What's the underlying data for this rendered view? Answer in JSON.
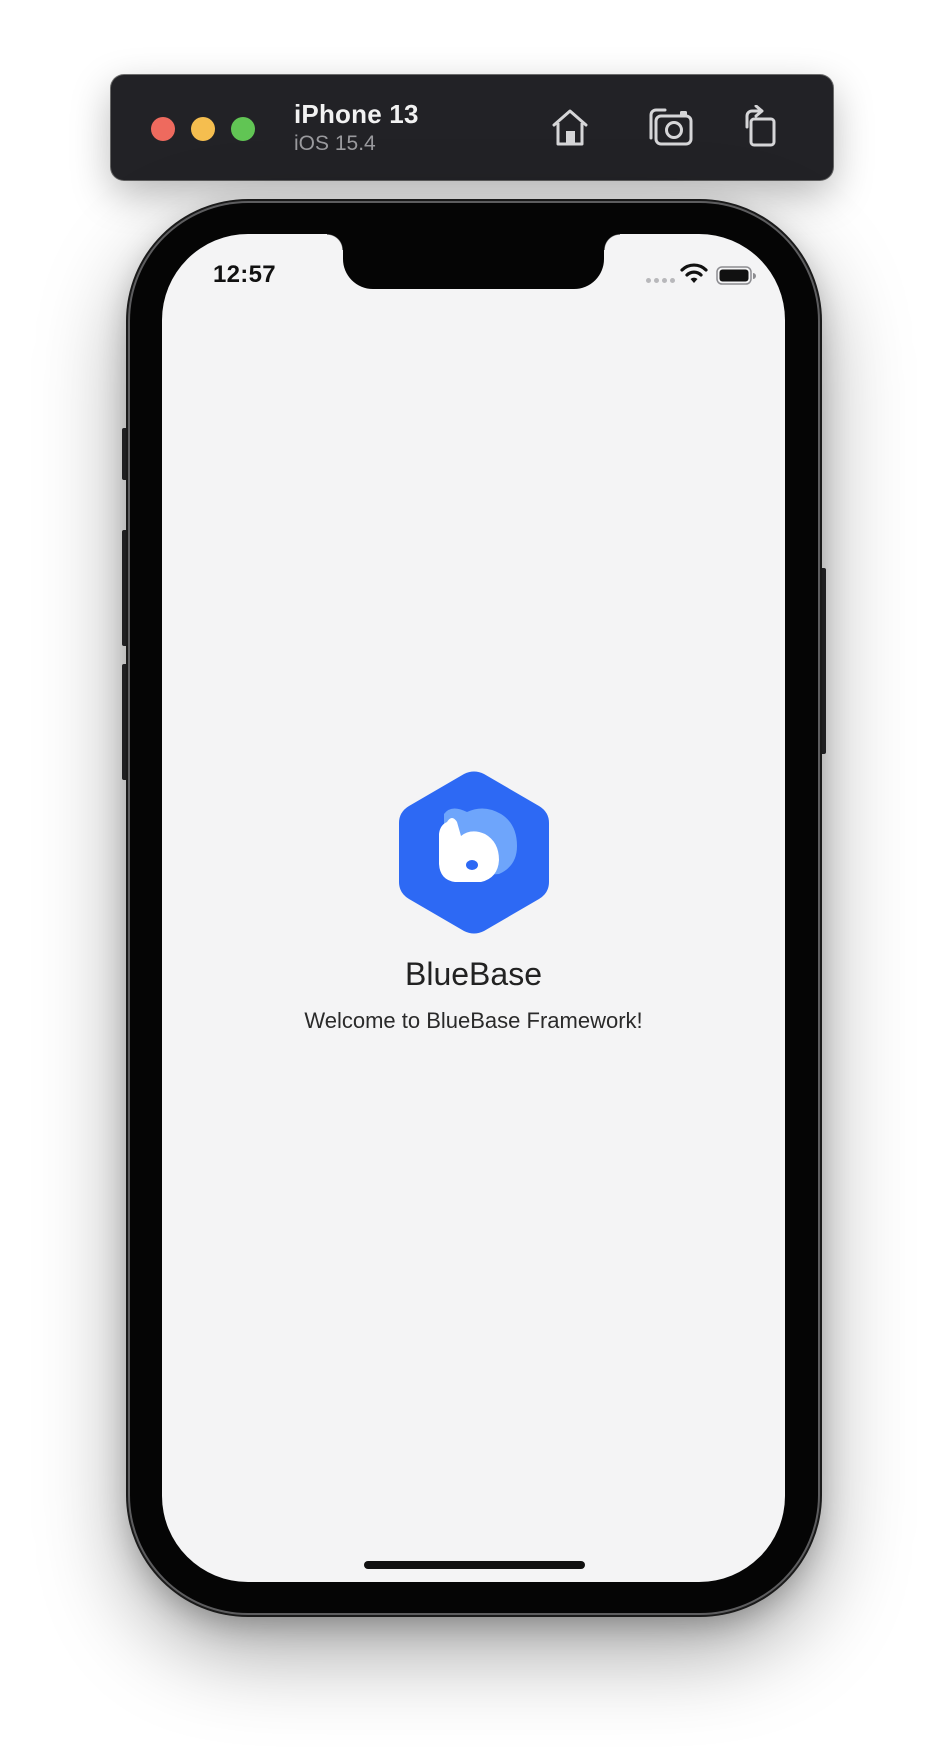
{
  "toolbar": {
    "device_name": "iPhone 13",
    "os_version": "iOS 15.4",
    "icons": {
      "close": "close-traffic-light",
      "minimize": "minimize-traffic-light",
      "zoom": "zoom-traffic-light",
      "home": "home-icon",
      "screenshot": "camera-icon",
      "rotate": "rotate-icon"
    },
    "colors": {
      "background": "#222226",
      "close": "#ee6a5e",
      "minimize": "#f5be4f",
      "zoom": "#61c554"
    }
  },
  "status_bar": {
    "time": "12:57",
    "icons": [
      "signal-icon",
      "wifi-icon",
      "battery-icon"
    ]
  },
  "app": {
    "title": "BlueBase",
    "subtitle": "Welcome to BlueBase Framework!",
    "logo": "bluebase-logo",
    "colors": {
      "brand": "#2d69f4",
      "brand_light": "#6ea5fb",
      "screen_background": "#f4f4f5"
    }
  }
}
